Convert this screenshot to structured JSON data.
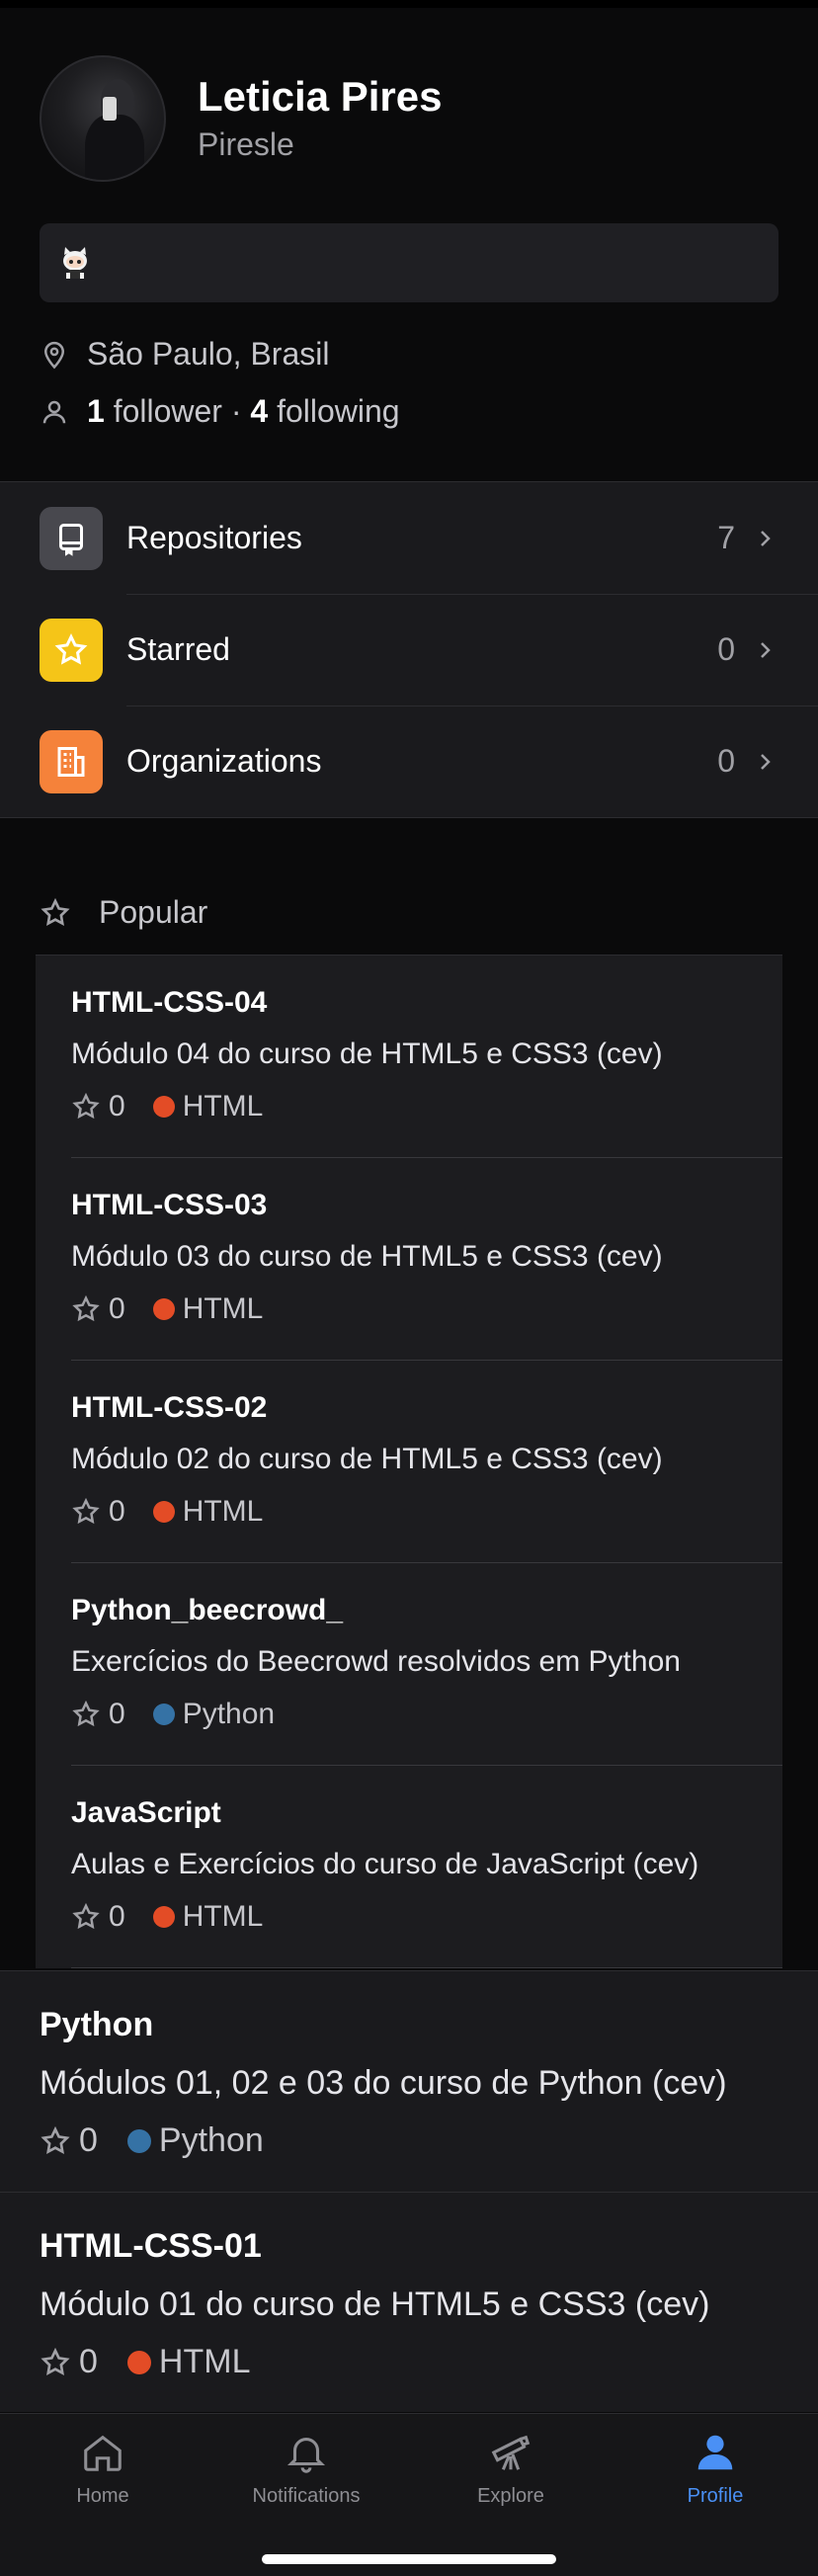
{
  "profile": {
    "display_name": "Leticia Pires",
    "username": "Piresle",
    "location": "São Paulo, Brasil",
    "followers_count": "1",
    "followers_label": "follower",
    "separator": "·",
    "following_count": "4",
    "following_label": "following"
  },
  "menu": {
    "items": [
      {
        "label": "Repositories",
        "count": "7",
        "icon": "repo-icon",
        "color": "#48484e"
      },
      {
        "label": "Starred",
        "count": "0",
        "icon": "star-icon",
        "color": "#f5c518"
      },
      {
        "label": "Organizations",
        "count": "0",
        "icon": "organization-icon",
        "color": "#f5823a"
      }
    ]
  },
  "popular": {
    "heading": "Popular",
    "items": [
      {
        "name": "HTML-CSS-04",
        "description": "Módulo 04 do curso de HTML5 e CSS3 (cev)",
        "stars": "0",
        "language": "HTML",
        "language_color": "#e34c26"
      },
      {
        "name": "HTML-CSS-03",
        "description": "Módulo 03 do curso de HTML5 e CSS3 (cev)",
        "stars": "0",
        "language": "HTML",
        "language_color": "#e34c26"
      },
      {
        "name": "HTML-CSS-02",
        "description": "Módulo 02 do curso de HTML5 e CSS3 (cev)",
        "stars": "0",
        "language": "HTML",
        "language_color": "#e34c26"
      },
      {
        "name": "Python_beecrowd_",
        "description": "Exercícios do Beecrowd resolvidos em Python",
        "stars": "0",
        "language": "Python",
        "language_color": "#3572a5"
      },
      {
        "name": "JavaScript",
        "description": "Aulas e Exercícios do curso de JavaScript (cev)",
        "stars": "0",
        "language": "HTML",
        "language_color": "#e34c26"
      }
    ]
  },
  "repositories": [
    {
      "name": "Python",
      "description": "Módulos 01, 02 e 03 do curso de Python (cev)",
      "stars": "0",
      "language": "Python",
      "language_color": "#3572a5"
    },
    {
      "name": "HTML-CSS-01",
      "description": "Módulo 01 do curso de HTML5 e CSS3 (cev)",
      "stars": "0",
      "language": "HTML",
      "language_color": "#e34c26"
    }
  ],
  "tabbar": {
    "tabs": [
      {
        "label": "Home",
        "icon": "home-icon"
      },
      {
        "label": "Notifications",
        "icon": "bell-icon"
      },
      {
        "label": "Explore",
        "icon": "telescope-icon"
      },
      {
        "label": "Profile",
        "icon": "person-icon"
      }
    ],
    "active": "Profile",
    "active_color": "#4a90f5"
  }
}
